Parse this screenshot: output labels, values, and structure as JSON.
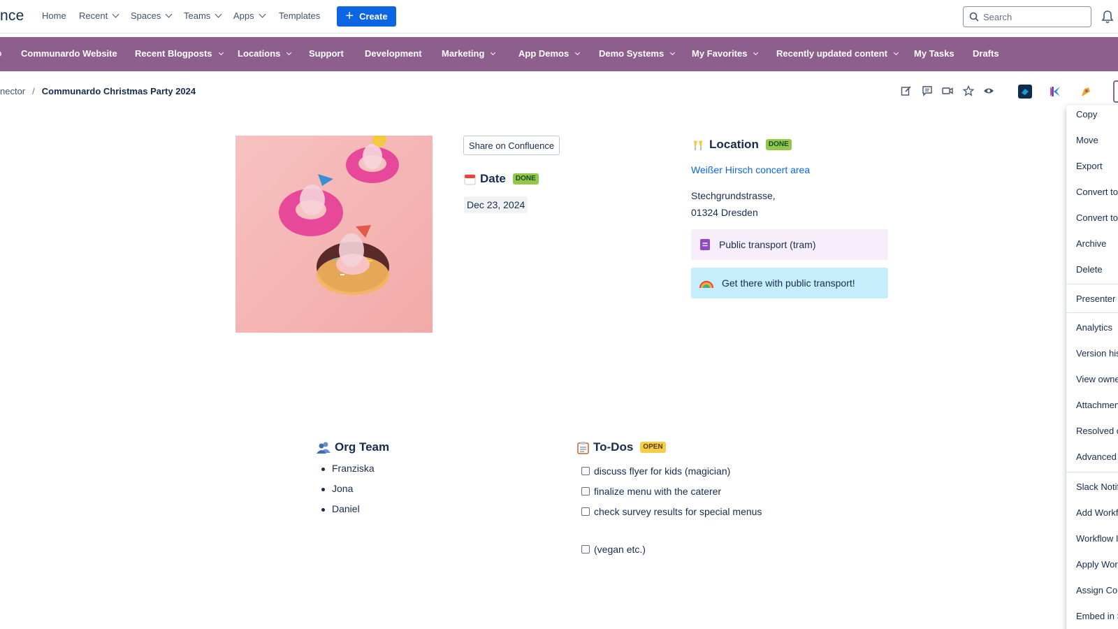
{
  "app": {
    "logo_text": "nce"
  },
  "topnav": {
    "items": [
      {
        "label": "Home"
      },
      {
        "label": "Recent"
      },
      {
        "label": "Spaces"
      },
      {
        "label": "Teams"
      },
      {
        "label": "Apps"
      },
      {
        "label": "Templates"
      }
    ],
    "create_label": "Create",
    "search_placeholder": "Search"
  },
  "purple_menu": {
    "items": [
      {
        "label": "Communardo Website"
      },
      {
        "label": "Recent Blogposts"
      },
      {
        "label": "Locations"
      },
      {
        "label": "Support"
      },
      {
        "label": "Development"
      },
      {
        "label": "Marketing"
      },
      {
        "label": "App Demos"
      },
      {
        "label": "Demo Systems"
      },
      {
        "label": "My Favorites"
      },
      {
        "label": "Recently updated content"
      },
      {
        "label": "My Tasks"
      },
      {
        "label": "Drafts"
      }
    ],
    "color": "#8c5f8c"
  },
  "breadcrumb": {
    "previous": "nector",
    "separator": "/",
    "current": "Communardo Christmas Party 2024"
  },
  "content": {
    "share_label": "Share on Confluence",
    "date": {
      "heading": "Date",
      "status": "DONE",
      "value": "Dec 23, 2024"
    },
    "location": {
      "heading": "Location",
      "status": "DONE",
      "link": "Weißer Hirsch concert area",
      "address_line1": "Stechgrundstrasse,",
      "address_line2": "01324 Dresden",
      "panel1": "Public transport (tram)",
      "panel2": "Get there with public transport!"
    },
    "org_team": {
      "heading": "Org Team",
      "members": [
        "Franziska",
        "Jona",
        "Daniel"
      ]
    },
    "todos": {
      "heading": "To-Dos",
      "status": "OPEN",
      "tasks": [
        "discuss flyer for kids (magician)",
        "finalize menu with the caterer",
        "check survey results for special menus",
        "(vegan etc.)"
      ]
    }
  },
  "menu": {
    "items": [
      "Copy",
      "Move",
      "Export",
      "Convert to",
      "Convert to",
      "Archive",
      "Delete",
      "Presenter m",
      "Analytics",
      "Version hist",
      "View owne",
      "Attachmen",
      "Resolved c",
      "Advanced d",
      "Slack Notif",
      "Add Workf",
      "Workflow I",
      "Apply Work",
      "Assign Con",
      "Embed in S"
    ]
  }
}
